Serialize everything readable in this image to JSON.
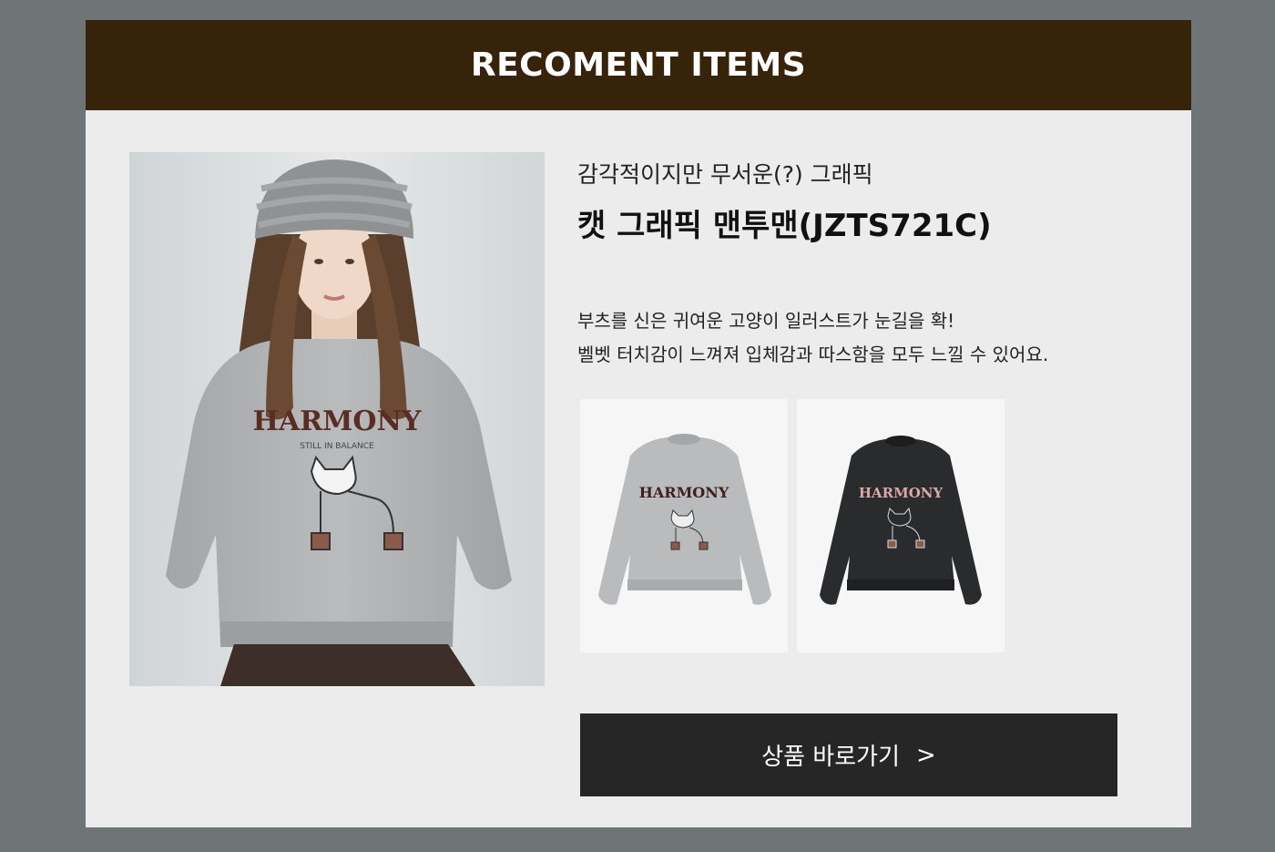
{
  "header": {
    "title": "RECOMENT ITEMS"
  },
  "product": {
    "subtitle": "감각적이지만 무서운(?) 그래픽",
    "title": "캣 그래픽 맨투맨(JZTS721C)",
    "description": [
      "부츠를 신은 귀여운 고양이 일러스트가 눈길을 확!",
      "벨벳 터치감이 느껴져 입체감과 따스함을 모두 느낄 수 있어요."
    ],
    "graphic_text": "HARMONY",
    "graphic_subtext": "STILL IN BALANCE"
  },
  "thumbnails": [
    {
      "color_name": "gray",
      "color": "#b9bbbc"
    },
    {
      "color_name": "black",
      "color": "#2a2b2d"
    }
  ],
  "cta": {
    "label": "상품 바로가기",
    "arrow": ">"
  },
  "colors": {
    "header_bg": "#37230a",
    "card_bg": "#ececec",
    "page_bg": "#6f7477",
    "button_bg": "#262626"
  }
}
